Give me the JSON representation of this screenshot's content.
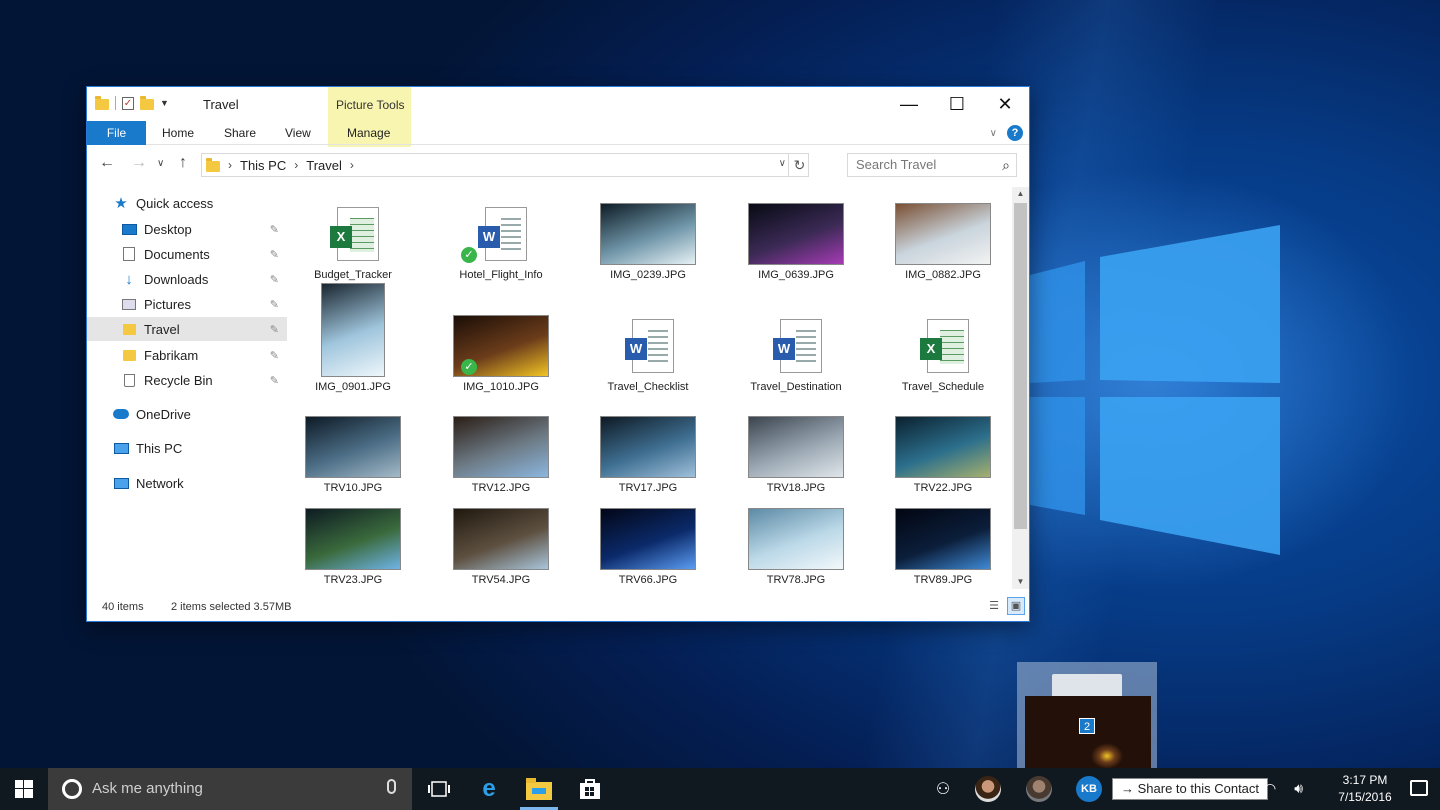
{
  "window": {
    "title": "Travel",
    "contextual_tab_group": "Picture Tools",
    "controls": {
      "minimize": "—",
      "maximize": "☐",
      "close": "✕"
    }
  },
  "ribbon": {
    "tabs": [
      "File",
      "Home",
      "Share",
      "View",
      "Manage"
    ],
    "help": "?"
  },
  "address": {
    "crumbs": [
      "This PC",
      "Travel"
    ],
    "search_placeholder": "Search Travel"
  },
  "nav_pane": {
    "items": [
      {
        "label": "Quick access",
        "icon": "star-icon"
      },
      {
        "label": "Desktop",
        "icon": "desktop-icon",
        "pinned": true
      },
      {
        "label": "Documents",
        "icon": "documents-icon",
        "pinned": true
      },
      {
        "label": "Downloads",
        "icon": "downloads-icon",
        "pinned": true
      },
      {
        "label": "Pictures",
        "icon": "pictures-icon",
        "pinned": true
      },
      {
        "label": "Travel",
        "icon": "folder-icon",
        "pinned": true,
        "selected": true
      },
      {
        "label": "Fabrikam",
        "icon": "folder-icon",
        "pinned": true
      },
      {
        "label": "Recycle Bin",
        "icon": "recycle-bin-icon",
        "pinned": true
      },
      {
        "label": "OneDrive",
        "icon": "onedrive-icon"
      },
      {
        "label": "This PC",
        "icon": "this-pc-icon"
      },
      {
        "label": "Network",
        "icon": "network-icon"
      }
    ]
  },
  "files": [
    {
      "name": "Budget_Tracker",
      "kind": "excel"
    },
    {
      "name": "Hotel_Flight_Info",
      "kind": "word",
      "synced": true
    },
    {
      "name": "IMG_0239.JPG",
      "kind": "image",
      "palette": [
        "#0e1d26",
        "#6f95a8",
        "#e6f1f5"
      ]
    },
    {
      "name": "IMG_0639.JPG",
      "kind": "image",
      "palette": [
        "#070a14",
        "#3b2a55",
        "#a63bb5"
      ]
    },
    {
      "name": "IMG_0882.JPG",
      "kind": "image",
      "palette": [
        "#7a5034",
        "#c9d4dc",
        "#f2f2f2"
      ]
    },
    {
      "name": "IMG_0901.JPG",
      "kind": "image",
      "palette": [
        "#1a2630",
        "#9fc5dc",
        "#eef6fb"
      ]
    },
    {
      "name": "IMG_1010.JPG",
      "kind": "image",
      "synced": true,
      "palette": [
        "#1b0e07",
        "#6b3c1a",
        "#f2c424"
      ]
    },
    {
      "name": "Travel_Checklist",
      "kind": "word"
    },
    {
      "name": "Travel_Destination",
      "kind": "word"
    },
    {
      "name": "Travel_Schedule",
      "kind": "excel"
    },
    {
      "name": "TRV10.JPG",
      "kind": "image",
      "palette": [
        "#0d1a26",
        "#4c6e86",
        "#a5bac8"
      ]
    },
    {
      "name": "TRV12.JPG",
      "kind": "image",
      "palette": [
        "#2b1e16",
        "#6d7b86",
        "#8bb6df"
      ]
    },
    {
      "name": "TRV17.JPG",
      "kind": "image",
      "palette": [
        "#0e1a24",
        "#3f6f92",
        "#9fc0da"
      ]
    },
    {
      "name": "TRV18.JPG",
      "kind": "image",
      "palette": [
        "#3b4550",
        "#9aa7b2",
        "#e0e6ea"
      ]
    },
    {
      "name": "TRV22.JPG",
      "kind": "image",
      "palette": [
        "#0b2130",
        "#2c6f8c",
        "#a6b06e"
      ]
    },
    {
      "name": "TRV23.JPG",
      "kind": "image",
      "palette": [
        "#0d1b22",
        "#3a6a3c",
        "#6fb3e6"
      ]
    },
    {
      "name": "TRV54.JPG",
      "kind": "image",
      "palette": [
        "#20180f",
        "#5d5040",
        "#a9c6dc"
      ]
    },
    {
      "name": "TRV66.JPG",
      "kind": "image",
      "palette": [
        "#020617",
        "#0b2a6a",
        "#5b9cf2"
      ]
    },
    {
      "name": "TRV78.JPG",
      "kind": "image",
      "palette": [
        "#5c8aa5",
        "#bcd9e8",
        "#f2f8fb"
      ]
    },
    {
      "name": "TRV89.JPG",
      "kind": "image",
      "palette": [
        "#020612",
        "#0b1e3a",
        "#3f8ad6"
      ]
    }
  ],
  "status": {
    "count": "40 items",
    "selection": "2 items selected  3.57MB"
  },
  "drag": {
    "count": "2"
  },
  "taskbar": {
    "search_placeholder": "Ask me anything",
    "contact_initials": "KB",
    "share_tooltip": "Share to this Contact",
    "time": "3:17 PM",
    "date": "7/15/2016"
  }
}
